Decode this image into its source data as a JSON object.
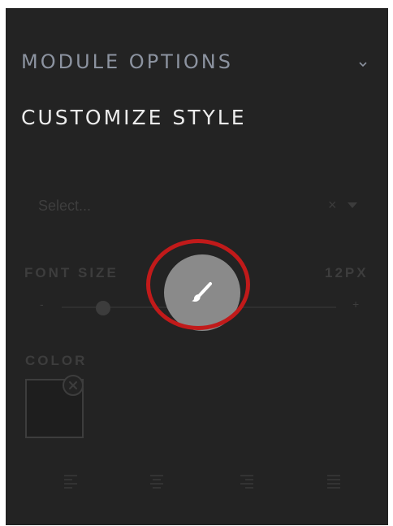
{
  "module": {
    "title": "MODULE OPTIONS",
    "chevron_icon": "chevron-down-icon"
  },
  "customize": {
    "title": "CUSTOMIZE STYLE"
  },
  "select": {
    "placeholder": "Select...",
    "clear_glyph": "×",
    "caret_icon": "caret-down-icon"
  },
  "font_size": {
    "label": "FONT SIZE",
    "value": "12PX",
    "minus": "-",
    "plus": "+",
    "slider_level": 0.15
  },
  "brush_button": {
    "icon": "paintbrush-icon",
    "highlight_color": "#c11a1a"
  },
  "color": {
    "label": "COLOR",
    "swatch_color": "#1e1e1e",
    "clear_icon": "close-circle-icon"
  },
  "alignment": [
    "align-left-icon",
    "align-center-icon",
    "align-right-icon",
    "align-justify-icon"
  ],
  "colors": {
    "panel_bg": "#232323",
    "muted_text": "#3d3d3d",
    "heading_text": "#ececec",
    "subheading_text": "#8c93a0",
    "brush_bg": "#8a8a8a"
  }
}
